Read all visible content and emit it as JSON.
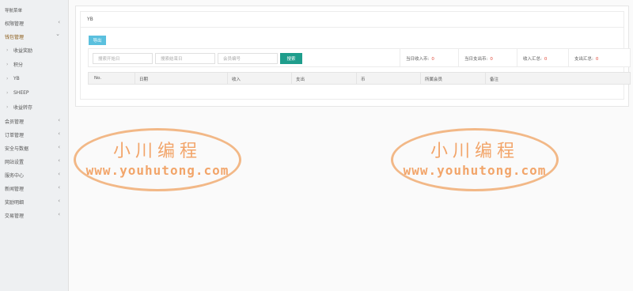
{
  "sidebar": {
    "title": "导航菜单",
    "items": [
      {
        "label": "权限管理",
        "chevron": "‹",
        "active": false
      },
      {
        "label": "钱包管理",
        "chevron": "⌄",
        "active": true
      },
      {
        "label": "会员管理",
        "chevron": "‹",
        "active": false
      },
      {
        "label": "订单管理",
        "chevron": "‹",
        "active": false
      },
      {
        "label": "安全与数据",
        "chevron": "‹",
        "active": false
      },
      {
        "label": "网站设置",
        "chevron": "‹",
        "active": false
      },
      {
        "label": "服务中心",
        "chevron": "‹",
        "active": false
      },
      {
        "label": "新闻管理",
        "chevron": "‹",
        "active": false
      },
      {
        "label": "奖励明细",
        "chevron": "‹",
        "active": false
      },
      {
        "label": "交易管理",
        "chevron": "‹",
        "active": false
      }
    ],
    "subitems": [
      {
        "label": "收益奖励"
      },
      {
        "label": "积分"
      },
      {
        "label": "YB"
      },
      {
        "label": "SHEEP"
      },
      {
        "label": "收益转存"
      }
    ]
  },
  "panel": {
    "title": "YB",
    "export_label": "导出",
    "search": {
      "start_placeholder": "搜索开始日",
      "end_placeholder": "搜索结束日",
      "member_placeholder": "会员编号",
      "button_label": "搜索"
    },
    "stats": [
      {
        "label": "当日收入币:",
        "value": "0"
      },
      {
        "label": "当日支出币:",
        "value": "0"
      },
      {
        "label": "收入汇总:",
        "value": "0"
      },
      {
        "label": "支出汇总:",
        "value": "0"
      }
    ],
    "table": {
      "columns": [
        "No.",
        "日期",
        "收入",
        "支出",
        "币",
        "所属会员",
        "备注"
      ],
      "rows": []
    }
  },
  "watermark": {
    "top_text": "小川编程",
    "bottom_text": "www.youhutong.com"
  },
  "colors": {
    "export_button": "#5bc0de",
    "search_button": "#1f9d8c",
    "stat_value": "#e24b3b",
    "watermark": "#f2a56a"
  }
}
